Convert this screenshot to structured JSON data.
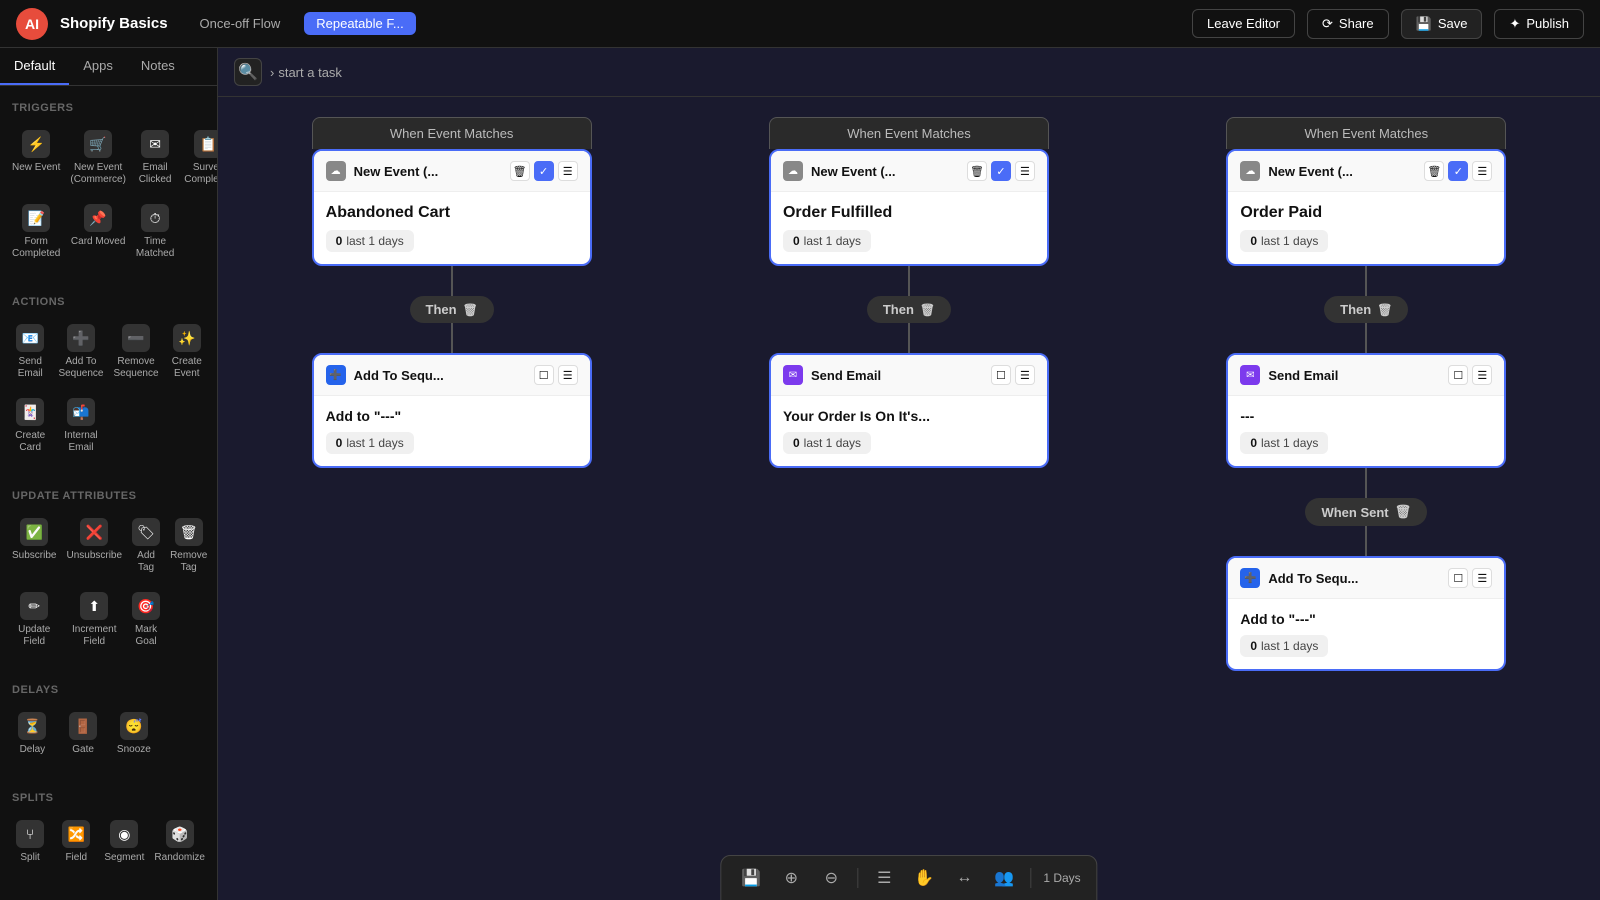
{
  "topbar": {
    "logo": "AI",
    "title": "Shopify Basics",
    "tabs": [
      {
        "id": "once-off",
        "label": "Once-off Flow",
        "active": false
      },
      {
        "id": "repeatable",
        "label": "Repeatable F...",
        "active": true
      }
    ],
    "leave_editor": "Leave Editor",
    "share": "Share",
    "save": "Save",
    "publish": "Publish"
  },
  "sidebar": {
    "tabs": [
      "Default",
      "Apps",
      "Notes"
    ],
    "active_tab": "Default",
    "sections": [
      {
        "title": "Triggers",
        "items": [
          {
            "id": "new-event",
            "label": "New Event",
            "icon": "⚡"
          },
          {
            "id": "new-event-commerce",
            "label": "New Event (Commerce)",
            "icon": "🛒"
          },
          {
            "id": "email-clicked",
            "label": "Email Clicked",
            "icon": "✉"
          },
          {
            "id": "survey-completed",
            "label": "Survey Completed",
            "icon": "📋"
          },
          {
            "id": "form-completed",
            "label": "Form Completed",
            "icon": "📝"
          },
          {
            "id": "card-moved",
            "label": "Card Moved",
            "icon": "📌"
          },
          {
            "id": "time-matched",
            "label": "Time Matched",
            "icon": "⏱"
          }
        ]
      },
      {
        "title": "Actions",
        "items": [
          {
            "id": "send-email",
            "label": "Send Email",
            "icon": "📧"
          },
          {
            "id": "add-to-sequence",
            "label": "Add To Sequence",
            "icon": "➕"
          },
          {
            "id": "remove-sequence",
            "label": "Remove Sequence",
            "icon": "➖"
          },
          {
            "id": "create-event",
            "label": "Create Event",
            "icon": "✨"
          },
          {
            "id": "create-card",
            "label": "Create Card",
            "icon": "🃏"
          },
          {
            "id": "internal-email",
            "label": "Internal Email",
            "icon": "📬"
          }
        ]
      },
      {
        "title": "Update Attributes",
        "items": [
          {
            "id": "subscribe",
            "label": "Subscribe",
            "icon": "✅"
          },
          {
            "id": "unsubscribe",
            "label": "Unsubscribe",
            "icon": "❌"
          },
          {
            "id": "add-tag",
            "label": "Add Tag",
            "icon": "🏷"
          },
          {
            "id": "remove-tag",
            "label": "Remove Tag",
            "icon": "🗑"
          },
          {
            "id": "update-field",
            "label": "Update Field",
            "icon": "✏"
          },
          {
            "id": "increment-field",
            "label": "Increment Field",
            "icon": "⬆"
          },
          {
            "id": "mark-goal",
            "label": "Mark Goal",
            "icon": "🎯"
          }
        ]
      },
      {
        "title": "Delays",
        "items": [
          {
            "id": "delay",
            "label": "Delay",
            "icon": "⏳"
          },
          {
            "id": "gate",
            "label": "Gate",
            "icon": "🚪"
          },
          {
            "id": "snooze",
            "label": "Snooze",
            "icon": "😴"
          }
        ]
      },
      {
        "title": "Splits",
        "items": [
          {
            "id": "split",
            "label": "Split",
            "icon": "⑂"
          },
          {
            "id": "field",
            "label": "Field",
            "icon": "🔀"
          },
          {
            "id": "segment",
            "label": "Segment",
            "icon": "◉"
          },
          {
            "id": "randomize",
            "label": "Randomize",
            "icon": "🎲"
          }
        ]
      }
    ]
  },
  "breadcrumb": {
    "text": "start a task"
  },
  "flow": {
    "columns": [
      {
        "id": "col1",
        "when_label": "When Event Matches",
        "trigger": {
          "title": "New Event (...",
          "event_name": "Abandoned Cart",
          "stat": "0 last 1 days"
        },
        "then_label": "Then",
        "action": {
          "type": "add-sequence",
          "title": "Add To Sequ...",
          "description": "Add to \"---\"",
          "stat": "0 last 1 days"
        }
      },
      {
        "id": "col2",
        "when_label": "When Event Matches",
        "trigger": {
          "title": "New Event (...",
          "event_name": "Order Fulfilled",
          "stat": "0 last 1 days"
        },
        "then_label": "Then",
        "action": {
          "type": "send-email",
          "title": "Send Email",
          "description": "Your Order Is On It's...",
          "stat": "0 last 1 days"
        }
      },
      {
        "id": "col3",
        "when_label": "When Event Matches",
        "trigger": {
          "title": "New Event (...",
          "event_name": "Order Paid",
          "stat": "0 last 1 days"
        },
        "then_label": "Then",
        "action": {
          "type": "send-email",
          "title": "Send Email",
          "description": "---",
          "stat": "0 last 1 days"
        },
        "when_sent_label": "When Sent",
        "sub_action": {
          "type": "add-sequence",
          "title": "Add To Sequ...",
          "description": "Add to \"---\"",
          "stat": "0 last 1 days"
        }
      }
    ]
  },
  "bottom_toolbar": {
    "buttons": [
      {
        "id": "save",
        "icon": "💾",
        "label": ""
      },
      {
        "id": "zoom-in",
        "icon": "🔍",
        "label": ""
      },
      {
        "id": "zoom-out",
        "icon": "🔎",
        "label": ""
      },
      {
        "id": "list",
        "icon": "☰",
        "label": ""
      },
      {
        "id": "hand",
        "icon": "✋",
        "label": ""
      },
      {
        "id": "arrows",
        "icon": "↔",
        "label": ""
      },
      {
        "id": "people",
        "icon": "👥",
        "label": ""
      }
    ],
    "days_label": "1 Days"
  }
}
